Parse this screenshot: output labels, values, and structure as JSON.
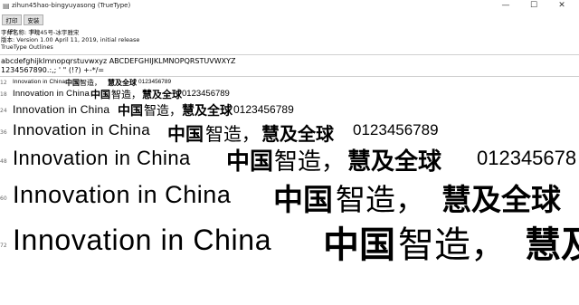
{
  "window": {
    "title": "zihun45hao-bingyuyasong (TrueType)",
    "minimize_glyph": "—",
    "maximize_glyph": "☐",
    "close_glyph": "✕"
  },
  "toolbar": {
    "print_label": "打印(P)",
    "install_label": "安装(I)"
  },
  "info": {
    "font_name": "字体名称: 字魂45号-冰宇雅宋",
    "version": "版本: Version 1.00 April 11, 2019, initial release",
    "outline": "TrueType Outlines"
  },
  "samples": {
    "alphabet": "abcdefghijklmnopqrstuvwxyz   ABCDEFGHIJKLMNOPQRSTUVWXYZ",
    "numbers": "1234567890.:,; ' \"  (!?)  +-*/="
  },
  "rows": [
    {
      "size": "12",
      "latin": "Innovation  in  China",
      "cjk_a": "中国",
      "cjk_b": "智造，",
      "cjk_c": "慧及全球",
      "digits": "0123456789"
    },
    {
      "size": "18",
      "latin": "Innovation  in  China",
      "cjk_a": "中国",
      "cjk_b": "智造，",
      "cjk_c": "慧及全球",
      "digits": "0123456789"
    },
    {
      "size": "24",
      "latin": "Innovation  in  China",
      "cjk_a": "中国",
      "cjk_b": "智造，",
      "cjk_c": "慧及全球",
      "digits": "0123456789"
    },
    {
      "size": "36",
      "latin": "Innovation  in  China",
      "cjk_a": "中国",
      "cjk_b": "智造，",
      "cjk_c": "慧及全球",
      "digits": "0123456789"
    },
    {
      "size": "48",
      "latin": "Innovation  in  China",
      "cjk_a": "中国",
      "cjk_b": "智造，",
      "cjk_c": "慧及全球",
      "digits": "012345678"
    },
    {
      "size": "60",
      "latin": "Innovation  in  China",
      "cjk_a": "中国",
      "cjk_b": "智造，",
      "cjk_c": "慧及全球",
      "digits": ""
    },
    {
      "size": "72",
      "latin": "Innovation  in  China",
      "cjk_a": "中国",
      "cjk_b": "智造，",
      "cjk_c": "慧及",
      "digits": ""
    }
  ]
}
